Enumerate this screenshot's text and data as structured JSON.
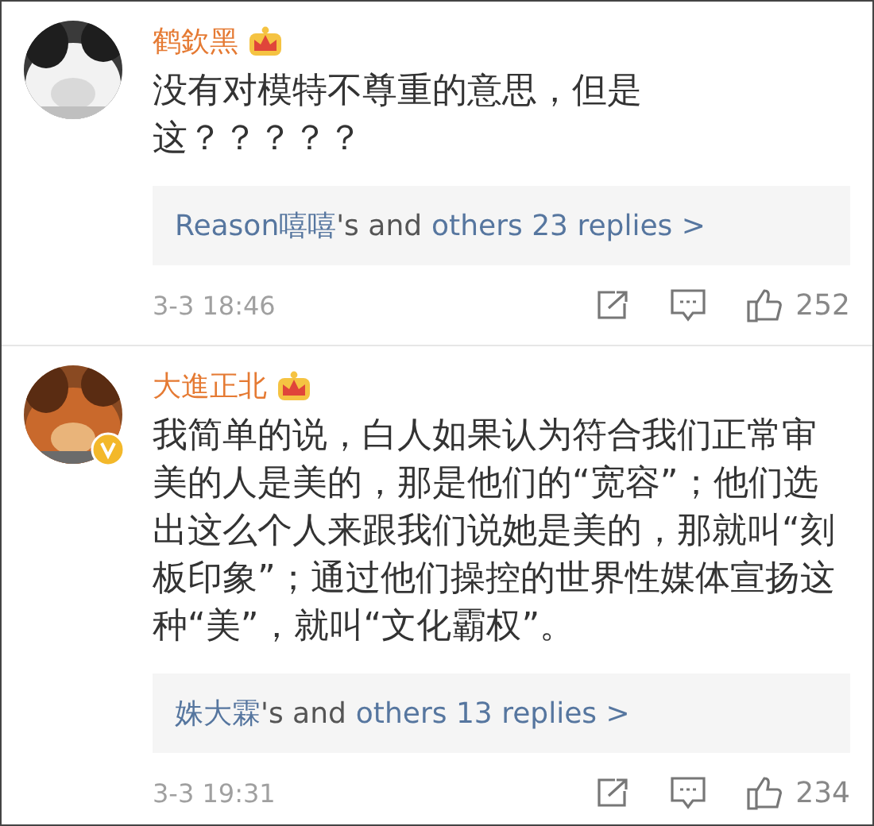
{
  "comments": [
    {
      "author": "鹤欽黑",
      "vip": true,
      "verified": false,
      "avatar": {
        "kind": "picture"
      },
      "text": [
        "没有对模特不尊重的意思，但是",
        "这？？？？？"
      ],
      "replies": {
        "first_replier": "Reason嘻嘻",
        "connector": "'s and",
        "others": "others 23 replies >"
      },
      "time": "3-3 18:46",
      "likes": "252"
    },
    {
      "author": "大進正北",
      "vip": true,
      "verified": true,
      "avatar": {
        "kind": "picture"
      },
      "text": [
        "我简单的说，白人如果认为符合我们正常审美的人是美的，那是他们的“宽容”；他们选出这么个人来跟我们说她是美的，那就叫“刻板印象”；通过他们操控的世界性媒体宣扬这种“美”，就叫“文化霸权”。"
      ],
      "replies": {
        "first_replier": "姝大霖",
        "connector": "'s and",
        "others": "others 13 replies >"
      },
      "time": "3-3 19:31",
      "likes": "234"
    }
  ]
}
